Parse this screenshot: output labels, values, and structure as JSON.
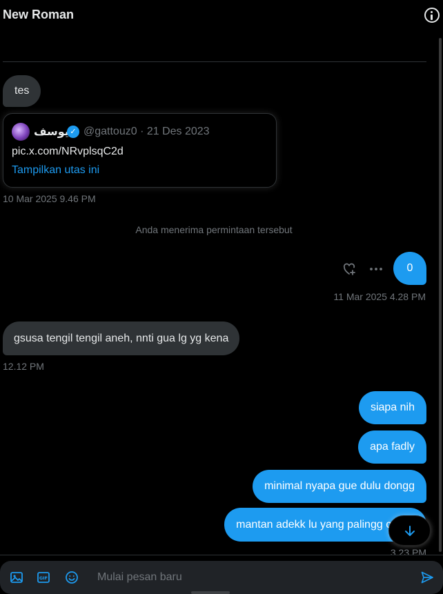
{
  "header": {
    "title": "New Roman",
    "info_icon": "info-circle-icon"
  },
  "messages": {
    "tes": "tes",
    "quoted_tweet": {
      "author_name": "يوسف",
      "verified_icon": "verified-badge-icon",
      "handle_date": "@gattouz0 · 21 Des 2023",
      "url": "pic.x.com/NRvplsqC2d",
      "link_text": "Tampilkan utas ini"
    },
    "timestamp_1": "10 Mar 2025 9.46 PM",
    "system_notice": "Anda menerima permintaan tersebut",
    "zero": "0",
    "timestamp_2": "11 Mar 2025 4.28 PM",
    "gsusa": "gsusa tengil tengil aneh, nnti gua lg yg kena",
    "timestamp_3": "12.12 PM",
    "siapa": "siapa nih",
    "apa": "apa fadly",
    "minimal": "minimal nyapa gue dulu dongg",
    "mantan": "mantan adekk lu yang palingg cantik",
    "timestamp_4": "3.23 PM"
  },
  "actions": {
    "react_icon": "heart-plus-icon",
    "more_icon": "more-horizontal-icon",
    "scroll_down_icon": "arrow-down-icon"
  },
  "composer": {
    "placeholder": "Mulai pesan baru",
    "icons": [
      "image-icon",
      "gif-icon",
      "emoji-icon",
      "send-icon"
    ]
  },
  "colors": {
    "accent": "#1d9bf0",
    "incoming_bubble": "#2f3336",
    "muted_text": "#71767b",
    "background": "#000000"
  }
}
